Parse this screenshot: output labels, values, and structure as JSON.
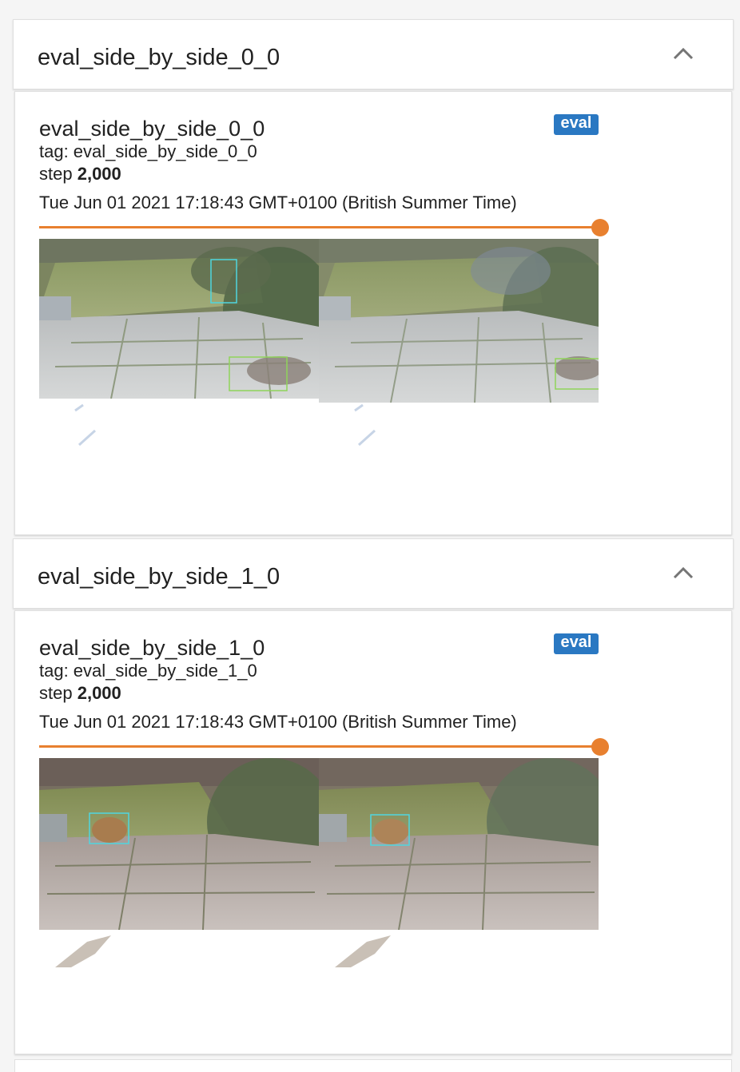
{
  "sections": [
    {
      "header_title": "eval_side_by_side_0_0",
      "card": {
        "title": "eval_side_by_side_0_0",
        "run_badge": "eval",
        "tag_label": "tag: eval_side_by_side_0_0",
        "step_prefix": "step",
        "step_value": "2,000",
        "timestamp": "Tue Jun 01 2021 17:18:43 GMT+0100 (British Summer Time)",
        "slider_fraction": 1.0
      }
    },
    {
      "header_title": "eval_side_by_side_1_0",
      "card": {
        "title": "eval_side_by_side_1_0",
        "run_badge": "eval",
        "tag_label": "tag: eval_side_by_side_1_0",
        "step_prefix": "step",
        "step_value": "2,000",
        "timestamp": "Tue Jun 01 2021 17:18:43 GMT+0100 (British Summer Time)",
        "slider_fraction": 1.0
      }
    }
  ],
  "colors": {
    "accent": "#e8802f",
    "badge": "#2a78c2",
    "box_cyan": "#4fd6e0",
    "box_green": "#8fd45a"
  },
  "icons": {
    "collapse": "chevron-up-icon"
  }
}
